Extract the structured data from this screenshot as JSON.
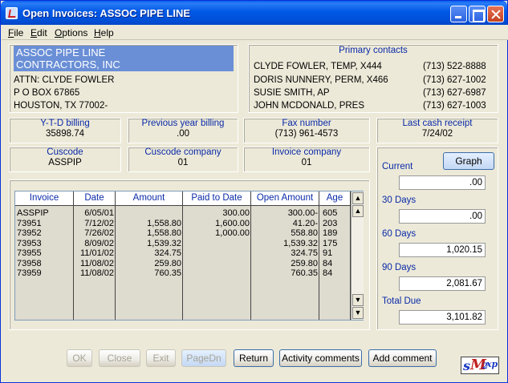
{
  "window": {
    "title": "Open Invoices:   ASSOC PIPE LINE"
  },
  "menu": [
    "File",
    "Edit",
    "Options",
    "Help"
  ],
  "address": {
    "name_line1": "ASSOC PIPE LINE",
    "name_line2": "CONTRACTORS, INC",
    "attn": "ATTN: CLYDE FOWLER",
    "street": "P O BOX 67865",
    "city": "HOUSTON, TX  77002-"
  },
  "contacts": {
    "label": "Primary contacts",
    "items": [
      {
        "name": "CLYDE FOWLER, TEMP, X444",
        "phone": "(713) 522-8888"
      },
      {
        "name": "DORIS NUNNERY, PERM, X466",
        "phone": "(713) 627-1002"
      },
      {
        "name": "SUSIE SMITH, AP",
        "phone": "(713) 627-6987"
      },
      {
        "name": "JOHN MCDONALD, PRES",
        "phone": "(713) 627-1003"
      }
    ]
  },
  "summary": {
    "ytd_label": "Y-T-D billing",
    "ytd_value": "35898.74",
    "prev_label": "Previous year billing",
    "prev_value": ".00",
    "fax_label": "Fax number",
    "fax_value": "(713) 961-4573",
    "cash_label": "Last cash receipt",
    "cash_value": "7/24/02",
    "cuscode_label": "Cuscode",
    "cuscode_value": "ASSPIP",
    "cuscomp_label": "Cuscode company",
    "cuscomp_value": "01",
    "invcomp_label": "Invoice company",
    "invcomp_value": "01"
  },
  "grid": {
    "headers": [
      "Invoice",
      "Date",
      "Amount",
      "Paid to Date",
      "Open Amount",
      "Age"
    ],
    "rows": [
      [
        "ASSPIP",
        "6/05/01",
        "",
        "300.00",
        "300.00-",
        "605"
      ],
      [
        "73951",
        "7/12/02",
        "1,558.80",
        "1,600.00",
        "41.20-",
        "203"
      ],
      [
        "73952",
        "7/26/02",
        "1,558.80",
        "1,000.00",
        "558.80",
        "189"
      ],
      [
        "73953",
        "8/09/02",
        "1,539.32",
        "",
        "1,539.32",
        "175"
      ],
      [
        "73955",
        "11/01/02",
        "324.75",
        "",
        "324.75",
        "91"
      ],
      [
        "73958",
        "11/08/02",
        "259.80",
        "",
        "259.80",
        "84"
      ],
      [
        "73959",
        "11/08/02",
        "760.35",
        "",
        "760.35",
        "84"
      ]
    ]
  },
  "aging": {
    "graph_label": "Graph",
    "current_label": "Current",
    "current_value": ".00",
    "d30_label": "30 Days",
    "d30_value": ".00",
    "d60_label": "60 Days",
    "d60_value": "1,020.15",
    "d90_label": "90 Days",
    "d90_value": "2,081.67",
    "total_label": "Total Due",
    "total_value": "3,101.82"
  },
  "buttons": {
    "ok": "OK",
    "close": "Close",
    "exit": "Exit",
    "pagedn": "PageDn",
    "return": "Return",
    "activity": "Activity comments",
    "add": "Add comment"
  },
  "logo": {
    "s": "s",
    "m": "M",
    "two": "2",
    "xp": "xp"
  },
  "colors": {
    "label_blue": "#0a2aa8",
    "titlebar": "#0058e6",
    "highlight": "#6a8fd6"
  }
}
